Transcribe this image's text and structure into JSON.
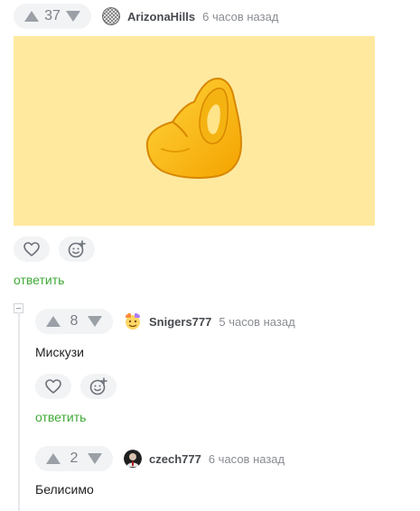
{
  "comments": [
    {
      "votes": "37",
      "author": "ArizonaHills",
      "time": "6 часов назад",
      "media_icon": "pinched-fingers-emoji",
      "reply_label": "ответить"
    },
    {
      "votes": "8",
      "author": "Snigers777",
      "time": "5 часов назад",
      "text": "Мискузи",
      "reply_label": "ответить"
    },
    {
      "votes": "2",
      "author": "czech777",
      "time": "6 часов назад",
      "text": "Белисимо"
    }
  ],
  "colors": {
    "reply_link": "#3eaa36",
    "media_background": "#fee99f",
    "pill_background": "#f2f3f5"
  },
  "icons": {
    "upvote": "arrow-up-icon",
    "downvote": "arrow-down-icon",
    "save": "heart-icon",
    "react": "emoji-plus-icon",
    "collapse": "minus-square-icon"
  }
}
